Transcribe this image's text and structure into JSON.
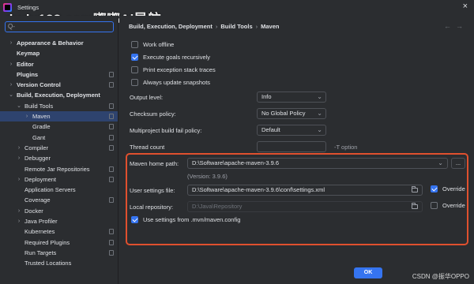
{
  "window": {
    "title": "Settings",
    "close_symbol": "×"
  },
  "watermark": {
    "text": "dudu123.com嘟嘟Ai导航",
    "corner": "CSDN @振华OPPO"
  },
  "search": {
    "placeholder": "Q-"
  },
  "sidebar": {
    "items": [
      {
        "label": "Appearance & Behavior",
        "indent": 0,
        "chevron": "›",
        "bold": true
      },
      {
        "label": "Keymap",
        "indent": 0,
        "chevron": "",
        "bold": true
      },
      {
        "label": "Editor",
        "indent": 0,
        "chevron": "›",
        "bold": true
      },
      {
        "label": "Plugins",
        "indent": 0,
        "chevron": "",
        "bold": true,
        "pin": true
      },
      {
        "label": "Version Control",
        "indent": 0,
        "chevron": "›",
        "bold": true,
        "pin": true
      },
      {
        "label": "Build, Execution, Deployment",
        "indent": 0,
        "chevron": "⌄",
        "bold": true
      },
      {
        "label": "Build Tools",
        "indent": 1,
        "chevron": "⌄",
        "bold": false,
        "pin": true
      },
      {
        "label": "Maven",
        "indent": 2,
        "chevron": "›",
        "bold": false,
        "selected": true,
        "pin": true
      },
      {
        "label": "Gradle",
        "indent": 2,
        "chevron": "",
        "bold": false,
        "pin": true
      },
      {
        "label": "Gant",
        "indent": 2,
        "chevron": "",
        "bold": false,
        "pin": true
      },
      {
        "label": "Compiler",
        "indent": 1,
        "chevron": "›",
        "bold": false,
        "pin": true
      },
      {
        "label": "Debugger",
        "indent": 1,
        "chevron": "›",
        "bold": false
      },
      {
        "label": "Remote Jar Repositories",
        "indent": 1,
        "chevron": "",
        "bold": false,
        "pin": true
      },
      {
        "label": "Deployment",
        "indent": 1,
        "chevron": "›",
        "bold": false,
        "pin": true
      },
      {
        "label": "Application Servers",
        "indent": 1,
        "chevron": "",
        "bold": false
      },
      {
        "label": "Coverage",
        "indent": 1,
        "chevron": "",
        "bold": false,
        "pin": true
      },
      {
        "label": "Docker",
        "indent": 1,
        "chevron": "›",
        "bold": false
      },
      {
        "label": "Java Profiler",
        "indent": 1,
        "chevron": "›",
        "bold": false
      },
      {
        "label": "Kubernetes",
        "indent": 1,
        "chevron": "",
        "bold": false,
        "pin": true
      },
      {
        "label": "Required Plugins",
        "indent": 1,
        "chevron": "",
        "bold": false,
        "pin": true
      },
      {
        "label": "Run Targets",
        "indent": 1,
        "chevron": "",
        "bold": false,
        "pin": true
      },
      {
        "label": "Trusted Locations",
        "indent": 1,
        "chevron": "",
        "bold": false
      }
    ]
  },
  "breadcrumb": {
    "parts": [
      "Build, Execution, Deployment",
      "Build Tools",
      "Maven"
    ],
    "sep": "›"
  },
  "nav": {
    "back": "←",
    "forward": "→"
  },
  "options": {
    "work_offline": {
      "label": "Work offline",
      "checked": false
    },
    "execute_goals": {
      "label": "Execute goals recursively",
      "checked": true
    },
    "print_stack": {
      "label": "Print exception stack traces",
      "checked": false
    },
    "always_update": {
      "label": "Always update snapshots",
      "checked": false
    }
  },
  "fields": {
    "output_level": {
      "label": "Output level:",
      "value": "Info"
    },
    "checksum_policy": {
      "label": "Checksum policy:",
      "value": "No Global Policy"
    },
    "fail_policy": {
      "label": "Multiproject build fail policy:",
      "value": "Default"
    },
    "thread_count": {
      "label": "Thread count",
      "value": "",
      "suffix": "-T option"
    },
    "maven_home": {
      "label": "Maven home path:",
      "value": "D:\\Software\\apache-maven-3.9.6",
      "browse": "...",
      "version": "(Version: 3.9.6)"
    },
    "user_settings": {
      "label": "User settings file:",
      "value": "D:\\Software\\apache-maven-3.9.6\\conf\\settings.xml",
      "override_label": "Override",
      "override_checked": true
    },
    "local_repo": {
      "label": "Local repository:",
      "value": "D:\\Java\\Repository",
      "override_label": "Override",
      "override_checked": false
    },
    "use_mvn_config": {
      "label": "Use settings from .mvn/maven.config",
      "checked": true
    }
  },
  "buttons": {
    "ok": "OK"
  },
  "colors": {
    "accent": "#3574f0",
    "highlight": "#e0502e",
    "background": "#2b2d30"
  }
}
